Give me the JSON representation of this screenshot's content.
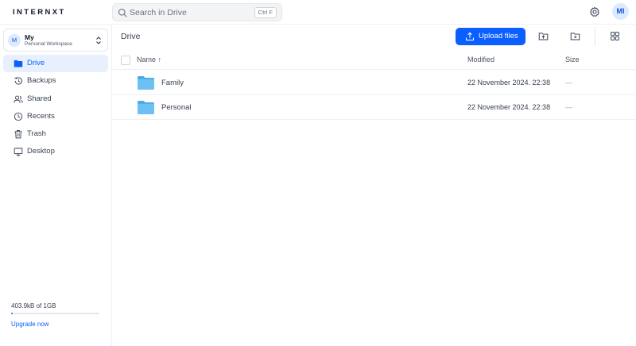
{
  "app": {
    "logo": "INTERNXT"
  },
  "search": {
    "placeholder": "Search in Drive",
    "shortcut": "Ctrl F"
  },
  "user": {
    "initials": "MI"
  },
  "workspace": {
    "initial": "M",
    "name": "My",
    "subtitle": "Personal Workspace"
  },
  "sidebar": {
    "items": [
      {
        "label": "Drive",
        "icon": "folder-icon",
        "active": true
      },
      {
        "label": "Backups",
        "icon": "history-icon"
      },
      {
        "label": "Shared",
        "icon": "users-icon"
      },
      {
        "label": "Recents",
        "icon": "clock-icon"
      },
      {
        "label": "Trash",
        "icon": "trash-icon"
      },
      {
        "label": "Desktop",
        "icon": "desktop-icon"
      }
    ]
  },
  "storage": {
    "usage": "403.9kB of 1GB",
    "used_fraction": 0.0004,
    "upgrade_label": "Upgrade now"
  },
  "main": {
    "breadcrumb": "Drive",
    "upload_label": "Upload files",
    "columns": {
      "name": "Name ↑",
      "modified": "Modified",
      "size": "Size"
    },
    "rows": [
      {
        "name": "Family",
        "modified": "22 November 2024. 22:38",
        "size": "—"
      },
      {
        "name": "Personal",
        "modified": "22 November 2024. 22:38",
        "size": "—"
      }
    ]
  },
  "colors": {
    "accent": "#0b5fff",
    "folder": "#5fb8f0",
    "active_bg": "#e8f0fd"
  }
}
